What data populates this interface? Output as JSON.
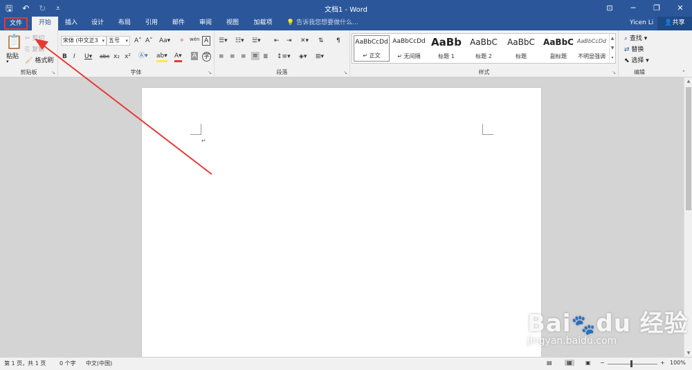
{
  "window": {
    "title": "文档1 - Word",
    "user": "Yicen Li",
    "share_label": "共享"
  },
  "tabs": [
    {
      "label": "文件"
    },
    {
      "label": "开始"
    },
    {
      "label": "插入"
    },
    {
      "label": "设计"
    },
    {
      "label": "布局"
    },
    {
      "label": "引用"
    },
    {
      "label": "邮件"
    },
    {
      "label": "审阅"
    },
    {
      "label": "视图"
    },
    {
      "label": "加载项"
    }
  ],
  "tell_me": "告诉我您想要做什么...",
  "clipboard": {
    "group_label": "剪贴板",
    "paste": "粘贴",
    "cut": "剪切",
    "copy": "复制",
    "format_painter": "格式刷"
  },
  "font": {
    "group_label": "字体",
    "font_name": "宋体 (中文正3",
    "font_size": "五号"
  },
  "paragraph": {
    "group_label": "段落"
  },
  "styles": {
    "group_label": "样式",
    "items": [
      {
        "sample": "AaBbCcDd",
        "name": "正文"
      },
      {
        "sample": "AaBbCcDd",
        "name": "无间隔"
      },
      {
        "sample": "AaBb",
        "name": "标题 1"
      },
      {
        "sample": "AaBbC",
        "name": "标题 2"
      },
      {
        "sample": "AaBbC",
        "name": "标题"
      },
      {
        "sample": "AaBbC",
        "name": "副标题"
      },
      {
        "sample": "AaBbCcDd",
        "name": "不明显强调"
      }
    ]
  },
  "editing": {
    "group_label": "编辑",
    "find": "查找",
    "replace": "替换",
    "select": "选择"
  },
  "status": {
    "page": "第 1 页，共 1 页",
    "words": "0 个字",
    "language": "中文(中国)",
    "zoom": "100%"
  },
  "watermark": {
    "url": "jingyan.baidu.com"
  },
  "colors": {
    "title_bar": "#2b579a",
    "annotation": "#e53935"
  }
}
